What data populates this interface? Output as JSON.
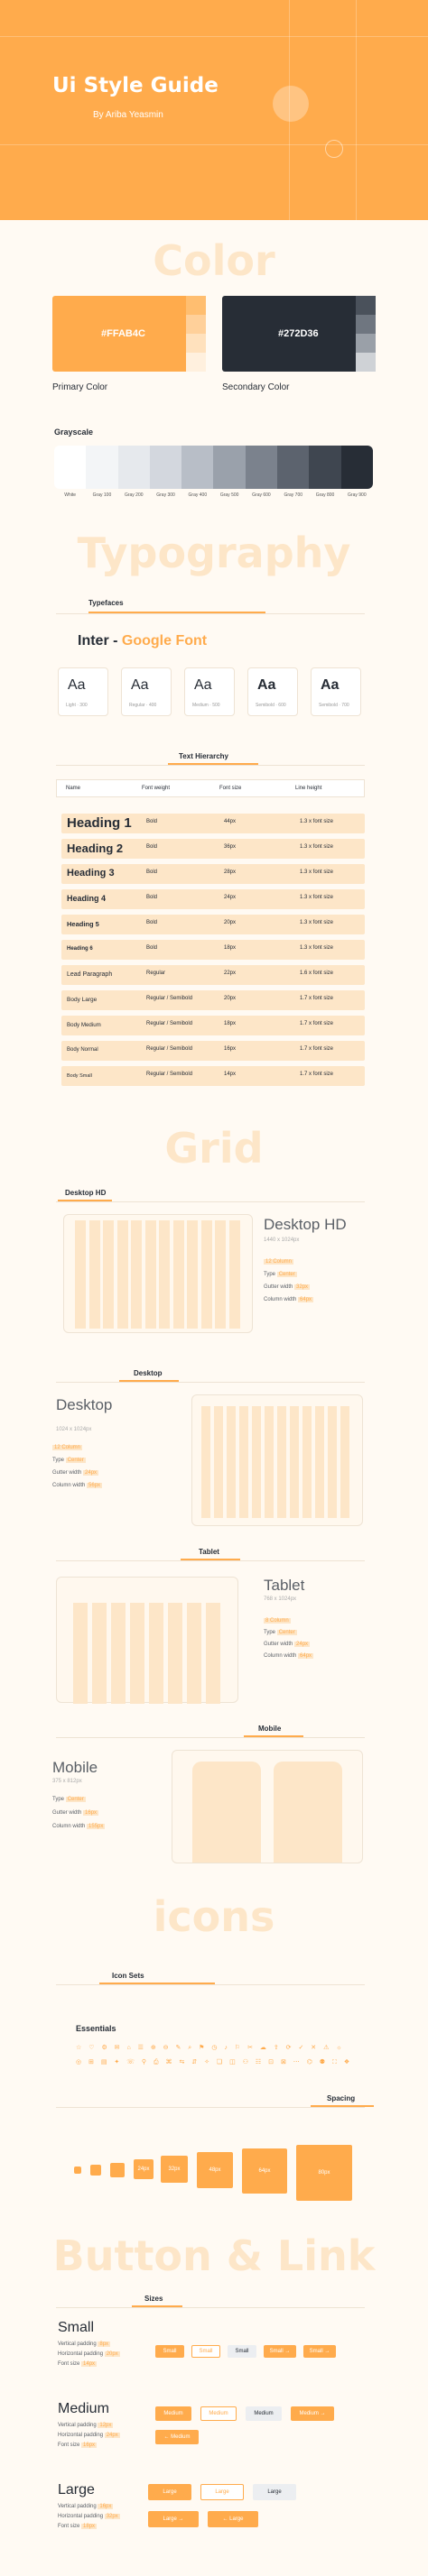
{
  "hero": {
    "title": "Ui Style Guide",
    "subtitle": "By Ariba Yeasmin"
  },
  "sections": {
    "color": "Color",
    "typography": "Typography",
    "grid": "Grid",
    "icons": "icons",
    "button": "Button & Link"
  },
  "colors": {
    "primary": {
      "hex": "#FFAB4C",
      "label": "Primary Color"
    },
    "secondary": {
      "hex": "#272D36",
      "label": "Secondary Color"
    }
  },
  "grayscale": {
    "title": "Grayscale",
    "items": [
      {
        "name": "White",
        "color": "#ffffff"
      },
      {
        "name": "Gray 100",
        "color": "#f3f5f7"
      },
      {
        "name": "Gray 200",
        "color": "#e6e9ed"
      },
      {
        "name": "Gray 300",
        "color": "#d3d7de"
      },
      {
        "name": "Gray 400",
        "color": "#b8bec7"
      },
      {
        "name": "Gray 500",
        "color": "#9aa1ab"
      },
      {
        "name": "Gray 600",
        "color": "#7b828d"
      },
      {
        "name": "Gray 700",
        "color": "#5c636e"
      },
      {
        "name": "Gray 800",
        "color": "#3f4650"
      },
      {
        "name": "Gray 900",
        "color": "#272d36"
      }
    ]
  },
  "typefaces": {
    "tab": "Typefaces",
    "font_prefix": "Inter -",
    "font_name": "Google Font",
    "weights": [
      {
        "aa": "Aa",
        "caption": "Light · 300"
      },
      {
        "aa": "Aa",
        "caption": "Regular · 400"
      },
      {
        "aa": "Aa",
        "caption": "Medium · 500"
      },
      {
        "aa": "Aa",
        "caption": "Semibold · 600"
      },
      {
        "aa": "Aa",
        "caption": "Semibold · 700"
      }
    ]
  },
  "hierarchy": {
    "tab": "Text Hierarchy",
    "headers": [
      "Name",
      "Font weight",
      "Font size",
      "Line height"
    ],
    "rows": [
      {
        "name": "Heading 1",
        "weight": "Bold",
        "size": "44px",
        "lh": "1.3 x font size"
      },
      {
        "name": "Heading 2",
        "weight": "Bold",
        "size": "36px",
        "lh": "1.3 x font size"
      },
      {
        "name": "Heading 3",
        "weight": "Bold",
        "size": "28px",
        "lh": "1.3 x font size"
      },
      {
        "name": "Heading 4",
        "weight": "Bold",
        "size": "24px",
        "lh": "1.3 x font size"
      },
      {
        "name": "Heading 5",
        "weight": "Bold",
        "size": "20px",
        "lh": "1.3 x font size"
      },
      {
        "name": "Heading 6",
        "weight": "Bold",
        "size": "18px",
        "lh": "1.3 x font size"
      },
      {
        "name": "Lead Paragraph",
        "weight": "Regular",
        "size": "22px",
        "lh": "1.6 x font size"
      },
      {
        "name": "Body Large",
        "weight": "Regular / Semibold",
        "size": "20px",
        "lh": "1.7 x font size"
      },
      {
        "name": "Body Medium",
        "weight": "Regular / Semibold",
        "size": "18px",
        "lh": "1.7 x font size"
      },
      {
        "name": "Body Normal",
        "weight": "Regular / Semibold",
        "size": "16px",
        "lh": "1.7 x font size"
      },
      {
        "name": "Body Small",
        "weight": "Regular / Semibold",
        "size": "14px",
        "lh": "1.7 x font size"
      }
    ]
  },
  "grids": {
    "desktop_hd": {
      "tab": "Desktop HD",
      "title": "Desktop HD",
      "size": "1440 x 1024px",
      "lines": [
        [
          "",
          "12 Column"
        ],
        [
          "Type",
          "Center"
        ],
        [
          "Gutter width",
          "32px"
        ],
        [
          "Column width",
          "64px"
        ]
      ]
    },
    "desktop": {
      "tab": "Desktop",
      "title": "Desktop",
      "size": "1024 x 1024px",
      "lines": [
        [
          "",
          "12 Column"
        ],
        [
          "Type",
          "Center"
        ],
        [
          "Gutter width",
          "24px"
        ],
        [
          "Column width",
          "56px"
        ]
      ]
    },
    "tablet": {
      "tab": "Tablet",
      "title": "Tablet",
      "size": "768 x 1024px",
      "lines": [
        [
          "",
          "8 Column"
        ],
        [
          "Type",
          "Center"
        ],
        [
          "Gutter width",
          "24px"
        ],
        [
          "Column width",
          "64px"
        ]
      ]
    },
    "mobile": {
      "tab": "Mobile",
      "title": "Mobile",
      "size": "375 x 812px",
      "lines": [
        [
          "Type",
          "Center"
        ],
        [
          "Gutter width",
          "16px"
        ],
        [
          "Column width",
          "155px"
        ]
      ]
    }
  },
  "icons": {
    "tab": "Icon Sets",
    "set_name": "Essentials",
    "row1": "☆ ♡ ⚙ ✉ ⌂ ☰ ⊕ ⊖ ✎ ⌕ ⚑ ◷ ♪ ⚐ ✂ ☁ ⇪ ⟳ ✓ ✕ ⚠ ☼",
    "row2": "◎ ⊞ ▤ ✦ ☏ ⚲ ⎙ ⌘ ⇆ ⇵ ✧ ❏ ◫ ⚇ ☷ ⊡ ⊠ ⋯ ⌬ ⚉ ⛶ ❖"
  },
  "spacing": {
    "tab": "Spacing",
    "items": [
      "4px",
      "8px",
      "16px",
      "24px",
      "32px",
      "48px",
      "64px",
      "80px"
    ]
  },
  "buttons": {
    "tab": "Sizes",
    "sizes": [
      {
        "name": "Small",
        "lines": [
          [
            "Vertical padding",
            "8px"
          ],
          [
            "Horizontal padding",
            "20px"
          ],
          [
            "Font size",
            "14px"
          ]
        ]
      },
      {
        "name": "Medium",
        "lines": [
          [
            "Vertical padding",
            "12px"
          ],
          [
            "Horizontal padding",
            "24px"
          ],
          [
            "Font size",
            "16px"
          ]
        ]
      },
      {
        "name": "Large",
        "lines": [
          [
            "Vertical padding",
            "16px"
          ],
          [
            "Horizontal padding",
            "32px"
          ],
          [
            "Font size",
            "18px"
          ]
        ]
      }
    ],
    "labels": {
      "small": "Small",
      "medium": "Medium",
      "large": "Large",
      "arrow_small": "Small →",
      "arrow_medium": "Medium →",
      "arrow_large": "Large →",
      "left_medium": "← Medium",
      "left_large": "← Large"
    }
  }
}
